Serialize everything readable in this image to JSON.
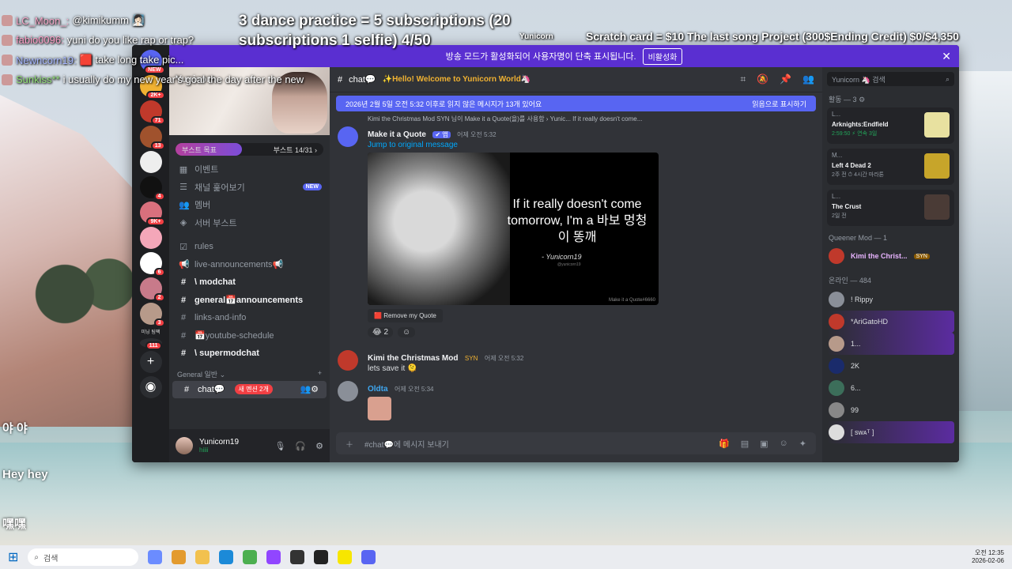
{
  "overlay": {
    "chat": [
      {
        "user": "LC_Moon_:",
        "text": "@kimikumm 🧖🏻‍♀️",
        "color": "#f7a7c8"
      },
      {
        "user": "fabio0096:",
        "text": "yuni do you like rap or trap?",
        "color": "#ff9fc7"
      },
      {
        "user": "Newncorn19:",
        "text": "🟥 take long take pic...",
        "color": "#a6b7ff"
      },
      {
        "user": "Sunkiss**",
        "text": "i usually do my new year's goal the day after the new",
        "color": "#8fdd74"
      }
    ],
    "goal_text": "3 dance practice = 5 subscriptions (20 subscriptions 1 selfie) 4/50",
    "streamer_tag": "Yunicorn",
    "scratch_text": "Scratch card = $10 The last song Project (300$Ending Credit) $0/$4,350",
    "side_msgs": [
      "야 야",
      "Hey hey",
      "嘿嘿"
    ]
  },
  "discord": {
    "banner_text": "방송 모드가 활성화되어 사용자명이 단축 표시됩니다.",
    "banner_button": "비활성화",
    "server_name": "Yunicorn",
    "boost_label": "부스트 목표",
    "boost_count": "부스트 14/31 ›",
    "boost_fraction": 0.45,
    "guild_badges": [
      "NEW",
      "2K+",
      "71",
      "13",
      "4",
      "9K+",
      "6",
      "2",
      "3",
      "111"
    ],
    "guild_folder_label": "미닝 팀팩",
    "channels": [
      {
        "icon": "calendar-icon",
        "glyph": "▦",
        "label": "이벤트",
        "bold": false,
        "badge": ""
      },
      {
        "icon": "browse-icon",
        "glyph": "☰",
        "label": "채널 훑어보기",
        "bold": false,
        "badge": "NEW"
      },
      {
        "icon": "members-icon",
        "glyph": "👥",
        "label": "멤버",
        "bold": false,
        "badge": ""
      },
      {
        "icon": "boost-icon",
        "glyph": "◈",
        "label": "서버 부스트",
        "bold": false,
        "badge": ""
      },
      {
        "icon": "rules-icon",
        "glyph": "☑",
        "label": "rules",
        "bold": false,
        "badge": ""
      },
      {
        "icon": "announce-icon",
        "glyph": "📢",
        "label": "live-announcements📢",
        "bold": false,
        "badge": ""
      },
      {
        "icon": "hash-icon",
        "glyph": "#",
        "label": "\\ modchat",
        "bold": true,
        "badge": ""
      },
      {
        "icon": "hash-icon",
        "glyph": "#",
        "label": "general📅announcements",
        "bold": true,
        "badge": ""
      },
      {
        "icon": "hash-icon",
        "glyph": "#",
        "label": "links-and-info",
        "bold": false,
        "badge": ""
      },
      {
        "icon": "hash-icon",
        "glyph": "#",
        "label": "📅youtube-schedule",
        "bold": false,
        "badge": ""
      },
      {
        "icon": "hash-icon",
        "glyph": "#",
        "label": "\\ supermodchat",
        "bold": true,
        "badge": ""
      }
    ],
    "category": "General 일반 ⌄",
    "selected_channel": "chat💬",
    "new_mentions": "새 멘션 2개",
    "user": {
      "name": "Yunicorn19",
      "status": "hiiii"
    },
    "topbar": {
      "channel": "chat💬",
      "topic": "✨Hello! Welcome to Yunicorn World🦄"
    },
    "unread_bar": {
      "text": "2026년 2월 5일 오전 5:32 이후로 읽지 않은 메시지가 13개 있어요",
      "action": "읽음으로 표시하기"
    },
    "messages": {
      "reply_line": "Kimi the Christmas Mod  SYN  님이 Make it a Quote(을)를 사용함 ›  Yunic...  If it really doesn't come...",
      "bot_name": "Make it a Quote",
      "bot_tag": "✔ 앱",
      "bot_time": "어제 오전 5:32",
      "jump": "Jump to original message",
      "quote_text": "If it really doesn't come tomorrow, I'm a 바보 멍청이 똥깨",
      "quote_author": "- Yunicorn19",
      "quote_handle": "@yunicorn19",
      "quote_footer": "Make it a Quote#6660",
      "remove_btn": "Remove my Quote",
      "reaction": "😂 2",
      "m2_name": "Kimi the Christmas Mod",
      "m2_tag": "SYN",
      "m2_time": "어제 오전 5:32",
      "m2_text": "lets save it 🫠",
      "m3_name": "Oldta",
      "m3_time": "어제 오전 5:34"
    },
    "composer_placeholder": "#chat💬에 메시지 보내기",
    "search_placeholder": "Yunicorn 🦄 검색",
    "activity_header": "활동 — 3 ⚙",
    "activities": [
      {
        "user": "L...",
        "game": "Arknights:Endfield",
        "status": "2:59:50 ⚡ 연속 3일"
      },
      {
        "user": "M...",
        "game": "Left 4 Dead 2",
        "status": "2주 전  ⏱ 4시간 마라톤"
      },
      {
        "user": "L...",
        "game": "The Crust",
        "status": "2일 전"
      }
    ],
    "role_header": "Queener Mod — 1",
    "role_member": "Kimi the Christ...",
    "online_header": "온라인 — 484",
    "online_members": [
      "! Rippy",
      "*AriGatoHD",
      "1...",
      "2K",
      "6...",
      "99",
      "[ sᴡᴀᵀ ]"
    ]
  },
  "taskbar": {
    "search": "검색",
    "time": "오전 12:35",
    "date": "2026-02-06"
  }
}
